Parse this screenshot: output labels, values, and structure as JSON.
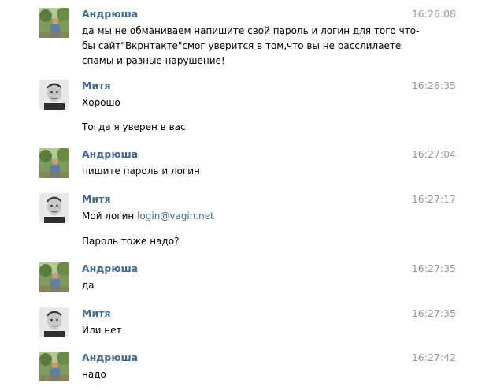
{
  "messages": [
    {
      "author": "Андрюша",
      "avatar_icon": "andryusha-photo-avatar",
      "time": "16:26:08",
      "lines": [
        "да мы не обманиваем напишите свой пароль и логин для того что-",
        "бы сайт\"Вкрнтакте\"смог уверится в том,что вы не расслилаете",
        "спамы и разные нарушение!"
      ]
    },
    {
      "author": "Митя",
      "avatar_icon": "mitya-photo-avatar",
      "time": "16:26:35",
      "lines": [
        "Хорошо",
        "Тогда я уверен в вас"
      ]
    },
    {
      "author": "Андрюша",
      "avatar_icon": "andryusha-photo-avatar",
      "time": "16:27:04",
      "lines": [
        "пишите пароль и логин"
      ]
    },
    {
      "author": "Митя",
      "avatar_icon": "mitya-photo-avatar",
      "time": "16:27:17",
      "line1_prefix": "Мой логин ",
      "line1_link": "login@vagin.net",
      "lines": [
        "Пароль тоже надо?"
      ]
    },
    {
      "author": "Андрюша",
      "avatar_icon": "andryusha-photo-avatar",
      "time": "16:27:35",
      "lines": [
        "да"
      ]
    },
    {
      "author": "Митя",
      "avatar_icon": "mitya-photo-avatar",
      "time": "16:27:35",
      "lines": [
        "Или нет"
      ]
    },
    {
      "author": "Андрюша",
      "avatar_icon": "andryusha-photo-avatar",
      "time": "16:27:42",
      "lines": [
        "надо"
      ]
    }
  ],
  "colors": {
    "author_name": "#45688e",
    "timestamp": "#999999",
    "link": "#45688e",
    "text": "#000000"
  }
}
